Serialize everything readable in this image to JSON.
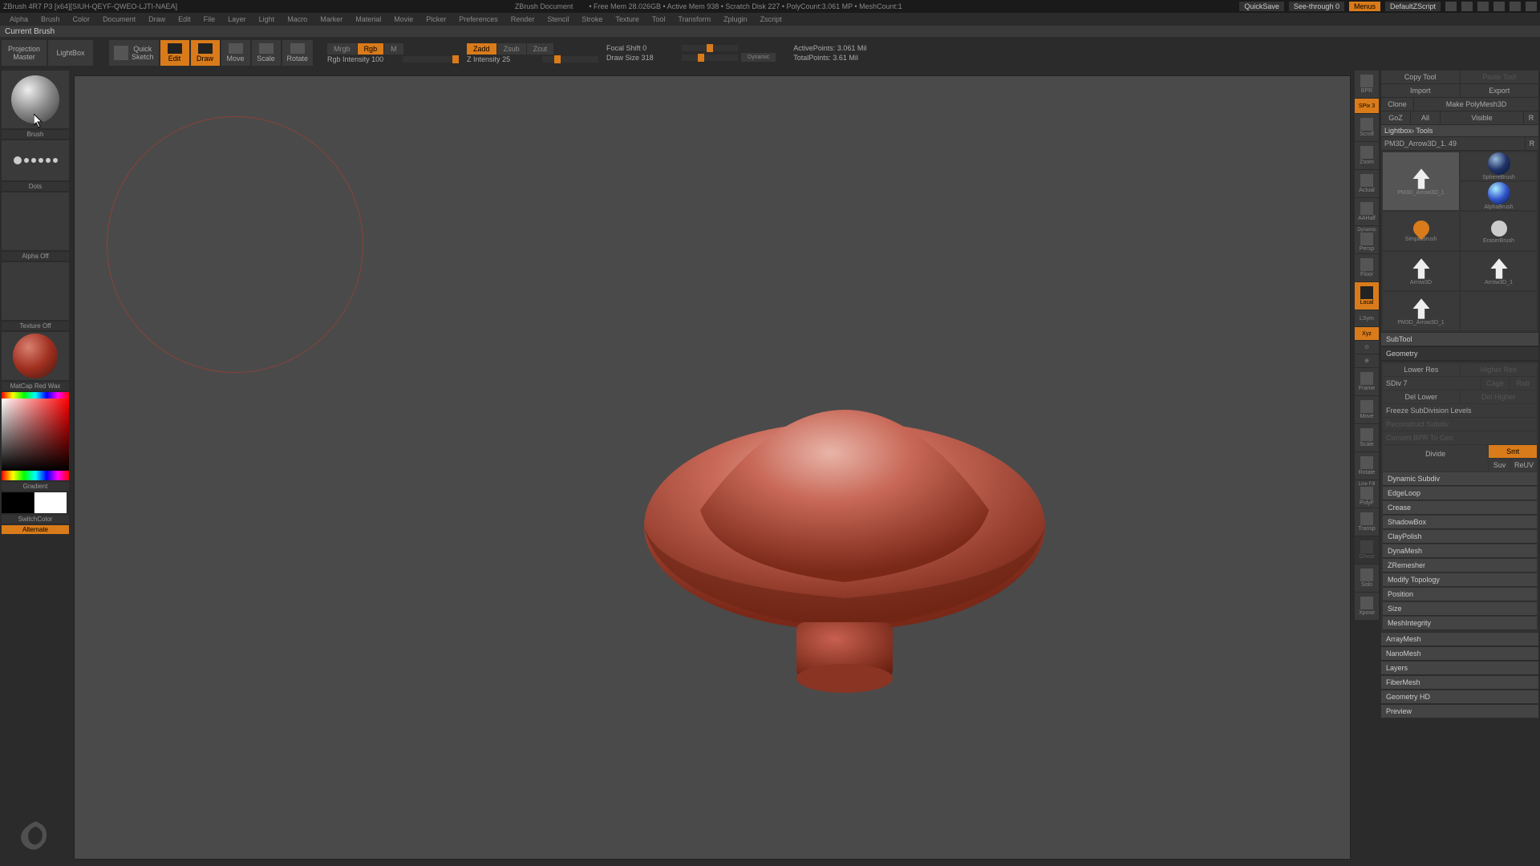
{
  "titlebar": {
    "app": "ZBrush 4R7 P3  [x64][SIUH-QEYF-QWEO-LJTI-NAEA]",
    "doc": "ZBrush Document",
    "mem": "• Free Mem 28.026GB  • Active Mem 938  • Scratch Disk 227  • PolyCount:3.061 MP  • MeshCount:1",
    "quicksave": "QuickSave",
    "seethrough": "See-through  0",
    "menus": "Menus",
    "script": "DefaultZScript"
  },
  "menubar": [
    "Alpha",
    "Brush",
    "Color",
    "Document",
    "Draw",
    "Edit",
    "File",
    "Layer",
    "Light",
    "Macro",
    "Marker",
    "Material",
    "Movie",
    "Picker",
    "Preferences",
    "Render",
    "Stencil",
    "Stroke",
    "Texture",
    "Tool",
    "Transform",
    "Zplugin",
    "Zscript"
  ],
  "toolinfo": "Current Brush",
  "toolbar": {
    "projection": "Projection\nMaster",
    "lightbox": "LightBox",
    "quicksketch": "Quick\nSketch",
    "edit": "Edit",
    "draw": "Draw",
    "move": "Move",
    "scale": "Scale",
    "rotate": "Rotate",
    "mrgb": "Mrgb",
    "rgb": "Rgb",
    "m": "M",
    "rgb_intensity": "Rgb Intensity 100",
    "zadd": "Zadd",
    "zsub": "Zsub",
    "zcut": "Zcut",
    "z_intensity": "Z Intensity 25",
    "focal_shift": "Focal Shift 0",
    "draw_size": "Draw Size 318",
    "dynamic": "Dynamic",
    "active_points": "ActivePoints: 3.061 Mil",
    "total_points": "TotalPoints: 3.61 Mil"
  },
  "left": {
    "brush": "Brush",
    "dots": "Dots",
    "alpha": "Alpha Off",
    "texture": "Texture Off",
    "material": "MatCap Red Wax",
    "gradient": "Gradient",
    "switchcolor": "SwitchColor",
    "alternate": "Alternate"
  },
  "rightTools": {
    "bpr": "BPR",
    "spix": "SPix 3",
    "scroll": "Scroll",
    "zoom": "Zoom",
    "actual": "Actual",
    "aahalf": "AAHalf",
    "dynamic": "Dynamic",
    "persp": "Persp",
    "floor": "Floor",
    "local": "Local",
    "lsym": "LSym",
    "xyz": "Xyz",
    "frame": "Frame",
    "move": "Move",
    "scale": "Scale",
    "rotate": "Rotate",
    "linefill": "Line Fill",
    "polyf": "PolyF",
    "transp": "Transp",
    "ghost": "Ghost",
    "solo": "Solo",
    "xpose": "Xpose"
  },
  "right": {
    "copytool": "Copy Tool",
    "pastetool": "Paste Tool",
    "import": "Import",
    "export": "Export",
    "clone": "Clone",
    "makepoly": "Make PolyMesh3D",
    "goz": "GoZ",
    "all": "All",
    "visible": "Visible",
    "r": "R",
    "lightbox_tools": "Lightbox› Tools",
    "toolname": "PM3D_Arrow3D_1. 49",
    "sphere": "SphereBrush",
    "alphabrush": "AlphaBrush",
    "tool_main": "PM3D_Arrow3D_1",
    "simple": "SimpleBrush",
    "eraser": "EraserBrush",
    "arrow3d": "Arrow3D",
    "arrow3d1": "Arrow3D_1",
    "arrow3d2": "PM3D_Arrow3D_1",
    "subtool": "SubTool",
    "geometry": "Geometry",
    "lower_res": "Lower Res",
    "higher_res": "Higher Res",
    "sdiv": "SDiv 7",
    "cage": "Cage",
    "rstr": "Rstr",
    "del_lower": "Del Lower",
    "del_higher": "Del Higher",
    "freeze": "Freeze SubDivision Levels",
    "reconstruct": "Reconstruct Subdiv",
    "convert": "Convert BPR To Geo",
    "divide": "Divide",
    "smt": "Smt",
    "suv": "Suv",
    "reuv": "ReUV",
    "sections": [
      "Dynamic Subdiv",
      "EdgeLoop",
      "Crease",
      "ShadowBox",
      "ClayPolish",
      "DynaMesh",
      "ZRemesher",
      "Modify Topology",
      "Position",
      "Size",
      "MeshIntegrity"
    ],
    "bottom": [
      "ArrayMesh",
      "NanoMesh",
      "Layers",
      "FiberMesh",
      "Geometry HD",
      "Preview"
    ]
  }
}
